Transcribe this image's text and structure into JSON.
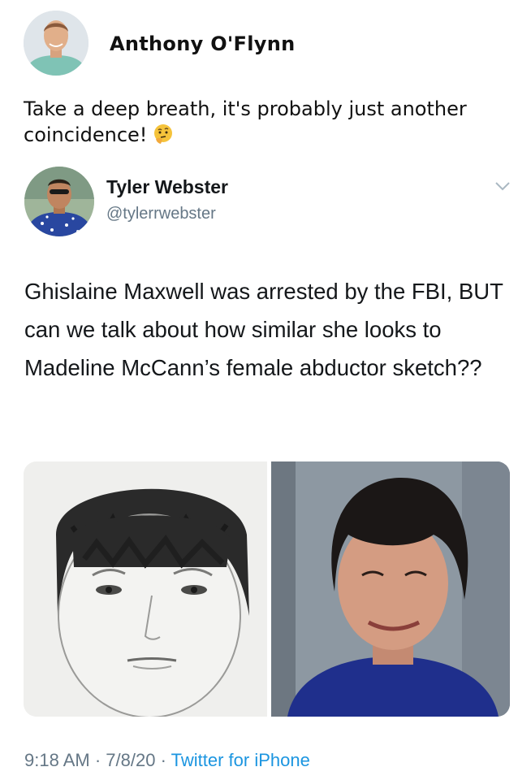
{
  "post": {
    "author_name": "Anthony O'Flynn",
    "caption": "Take a deep breath, it's probably just another coincidence!",
    "caption_emoji_icon": "thinking-face-icon"
  },
  "tweet": {
    "display_name": "Tyler Webster",
    "handle": "@tylerrwebster",
    "text": "Ghislaine Maxwell was arrested by the FBI, BUT can we talk about how similar she looks to Madeline McCann’s female abductor sketch??",
    "menu_icon": "chevron-down-icon",
    "media": [
      {
        "description_icon": "sketch-portrait-image"
      },
      {
        "description_icon": "photo-portrait-image"
      }
    ],
    "time": "9:18 AM",
    "date": "7/8/20",
    "separator": "·",
    "source": "Twitter for iPhone"
  },
  "colors": {
    "secondary_text": "#657786",
    "link": "#1b95e0",
    "primary_text": "#14171a"
  }
}
